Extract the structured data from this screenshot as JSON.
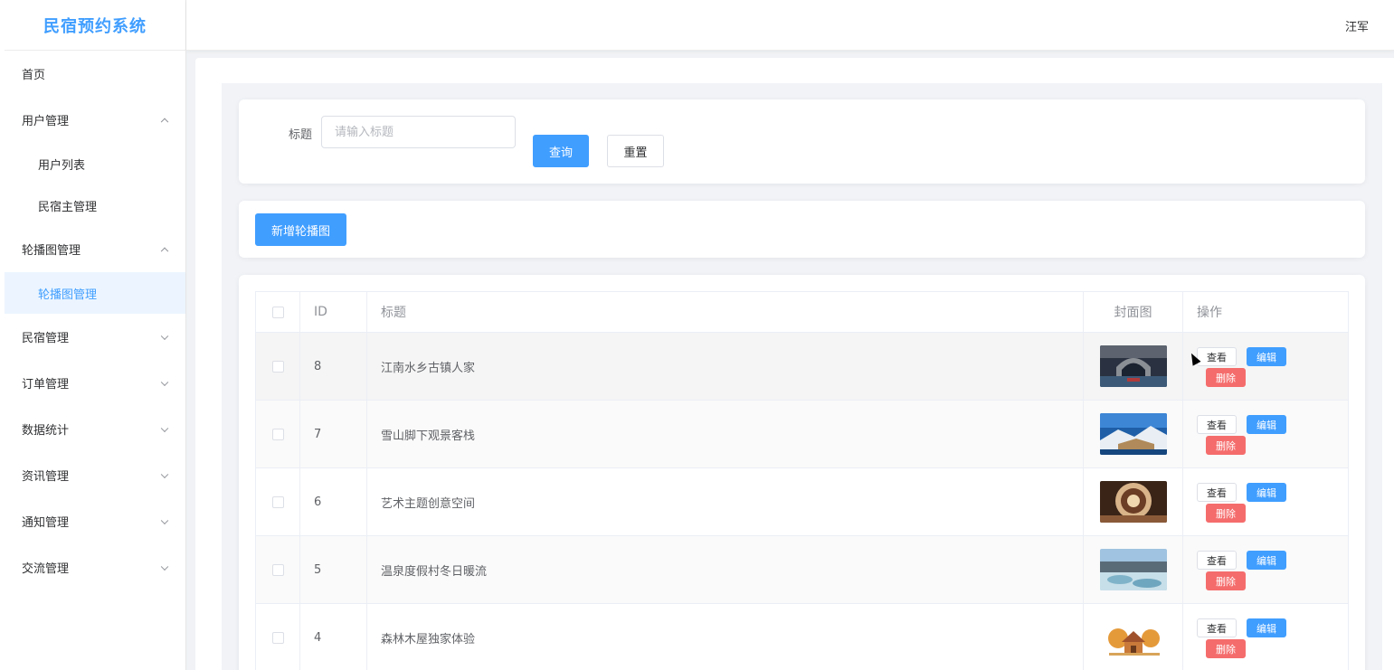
{
  "app": {
    "title": "民宿预约系统",
    "user": "汪军"
  },
  "sidebar": {
    "items": [
      {
        "label": "首页"
      },
      {
        "label": "用户管理",
        "expanded": true,
        "children": [
          {
            "label": "用户列表"
          },
          {
            "label": "民宿主管理"
          }
        ]
      },
      {
        "label": "轮播图管理",
        "expanded": true,
        "children": [
          {
            "label": "轮播图管理",
            "active": true
          }
        ]
      },
      {
        "label": "民宿管理"
      },
      {
        "label": "订单管理"
      },
      {
        "label": "数据统计"
      },
      {
        "label": "资讯管理"
      },
      {
        "label": "通知管理"
      },
      {
        "label": "交流管理"
      }
    ]
  },
  "search": {
    "label": "标题",
    "placeholder": "请输入标题",
    "value": "",
    "query_label": "查询",
    "reset_label": "重置"
  },
  "actions": {
    "add_label": "新增轮播图"
  },
  "table": {
    "columns": [
      "ID",
      "标题",
      "封面图",
      "操作"
    ],
    "rows": [
      {
        "id": "8",
        "title": "江南水乡古镇人家"
      },
      {
        "id": "7",
        "title": "雪山脚下观景客栈"
      },
      {
        "id": "6",
        "title": "艺术主题创意空间"
      },
      {
        "id": "5",
        "title": "温泉度假村冬日暖流"
      },
      {
        "id": "4",
        "title": "森林木屋独家体验"
      }
    ],
    "row_actions": {
      "view": "查看",
      "edit": "编辑",
      "delete": "删除"
    }
  },
  "colors": {
    "accent": "#409eff",
    "danger": "#f56c6c",
    "active_bg": "#ecf5ff"
  }
}
